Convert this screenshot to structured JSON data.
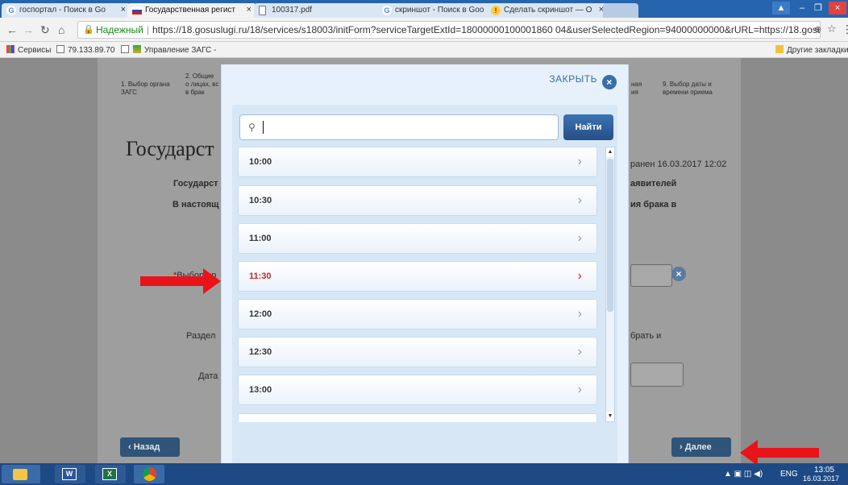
{
  "browser": {
    "tabs": [
      {
        "title": "госпортал - Поиск в Go",
        "active": false
      },
      {
        "title": "Государственная регист",
        "active": true
      },
      {
        "title": "100317.pdf",
        "active": false
      },
      {
        "title": "скриншот - Поиск в Goo",
        "active": false
      },
      {
        "title": "Сделать скриншот — О",
        "active": false
      }
    ],
    "secure_label": "Надежный",
    "url": "https://18.gosuslugi.ru/18/services/s18003/initForm?serviceTargetExtId=18000000100001860 04&userSelectedRegion=94000000000&rURL=https://18.gosuslugi.ru/pgu/",
    "bookmarks": [
      "Сервисы",
      "79.133.89.70",
      "Управление ЗАГС -",
      "Другие закладки"
    ]
  },
  "page": {
    "steps": [
      {
        "text": "1. Выбор органа\nЗАГС"
      },
      {
        "text": "2. Общие\nо лицах, вс\nв брак"
      },
      {
        "text": "ная\nия"
      },
      {
        "text": "9. Выбор даты и\nвремени приема"
      }
    ],
    "title": "Государст",
    "saved": "ранен 16.03.2017 12:02",
    "lines": {
      "l1_left": "Государст",
      "l1_right": "аявителей",
      "l2_left": "В настоящ",
      "l2_right": "ия брака в",
      "field_label": "Выбор ор",
      "section_label": "Раздел",
      "section_right": "брать и",
      "date_label": "Дата"
    },
    "back_label": "Назад",
    "next_label": "Далее"
  },
  "modal": {
    "close_label": "ЗАКРЫТЬ",
    "search_placeholder": "",
    "find_label": "Найти",
    "times": [
      "10:00",
      "10:30",
      "11:00",
      "11:30",
      "12:00",
      "12:30",
      "13:00"
    ],
    "selected_time": "11:30"
  },
  "taskbar": {
    "lang": "ENG",
    "time": "13:05",
    "date": "16.03.2017"
  },
  "colors": {
    "accent": "#3a6ea8",
    "selected_red": "#d02424",
    "arrow_red": "#e8141a"
  }
}
